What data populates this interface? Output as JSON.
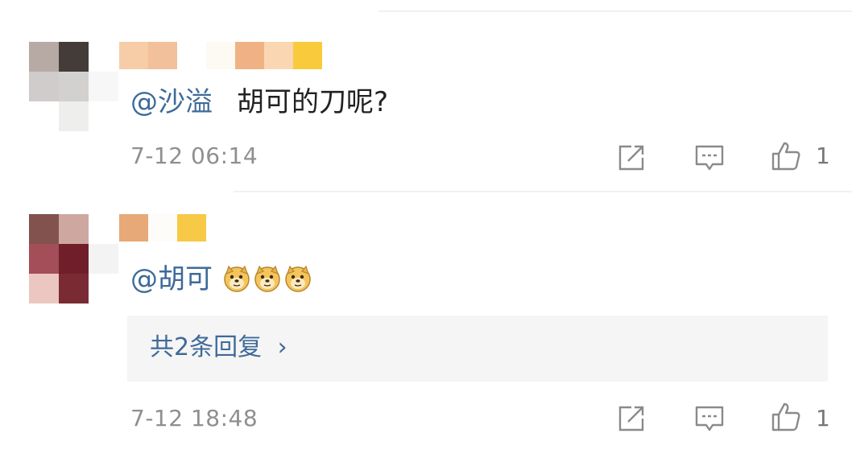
{
  "comments": [
    {
      "mention": "@沙溢",
      "text": "胡可的刀呢?",
      "timestamp": "7-12 06:14",
      "like_count": "1"
    },
    {
      "mention": "@胡可",
      "text": "",
      "emojis": [
        "doge-emoji",
        "doge-emoji",
        "doge-emoji"
      ],
      "replies_label": "共2条回复",
      "replies_chevron": "›",
      "timestamp": "7-12 18:48",
      "like_count": "1"
    }
  ],
  "icons": {
    "share": "share-icon",
    "comment": "comment-icon",
    "like": "thumbs-up-icon"
  },
  "colors": {
    "mention_link": "#3f6a99",
    "timestamp": "#8f8f8f",
    "reply_box_bg": "#f5f5f5"
  }
}
